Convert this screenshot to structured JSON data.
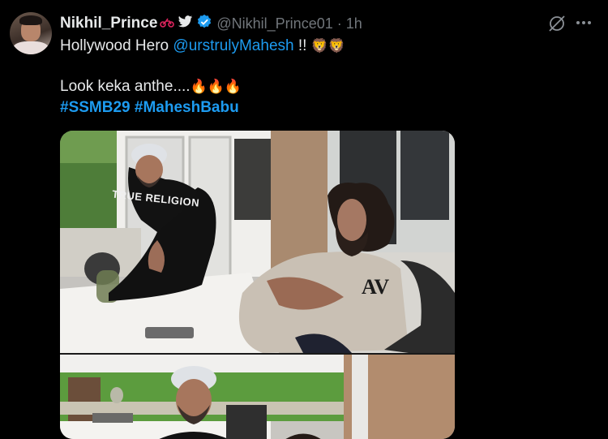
{
  "author": {
    "display_name": "Nikhil_Prince",
    "handle": "@Nikhil_Prince01",
    "separator": "·",
    "time": "1h"
  },
  "icons": {
    "bike": "motorbike-icon",
    "bird": "twitter-bird-icon",
    "verified": "verified-badge-icon",
    "grok": "grok-icon",
    "more": "more-icon"
  },
  "tweet": {
    "line1_prefix": "Hollywood Hero ",
    "mention": "@urstrulyMahesh",
    "line1_suffix": " !!",
    "line1_emoji": "🦁🦁",
    "line2_text": "Look keka anthe....",
    "line2_emoji": "🔥🔥🔥",
    "hashtag1": "#SSMB29",
    "hashtag2": "#MaheshBabu"
  },
  "media": {
    "shirt_print": "TRUE RELIGION",
    "shirt_logo": "AV"
  },
  "colors": {
    "background": "#000000",
    "text": "#e7e9ea",
    "muted": "#71767b",
    "link": "#1d9bf0",
    "verified": "#1d9bf0"
  }
}
